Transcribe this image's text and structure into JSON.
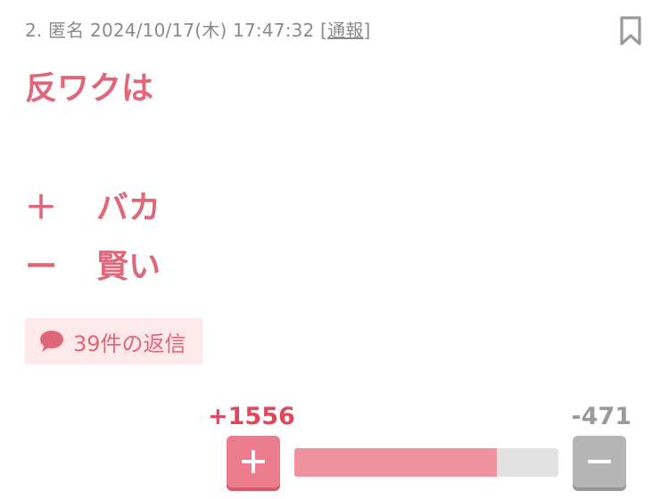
{
  "meta": {
    "number": "2.",
    "author": "匿名",
    "datetime": "2024/10/17(木) 17:47:32",
    "report_open": "[",
    "report_label": "通報",
    "report_close": "]"
  },
  "body": {
    "title": "反ワクは",
    "plus_mark": "＋",
    "plus_text": "バカ",
    "minus_mark": "ー",
    "minus_text": "賢い"
  },
  "replies": {
    "label": "39件の返信"
  },
  "votes": {
    "plus_count": "+1556",
    "minus_count": "-471",
    "plus_ratio": 0.768
  },
  "colors": {
    "accent": "#e0667a",
    "plus": "#ec7c8c",
    "minus": "#b5b5b5",
    "reply_bg": "#fde8ea"
  },
  "icons": {
    "bookmark": "bookmark-icon",
    "reply": "speech-bubble-icon",
    "plus": "plus-icon",
    "minus": "minus-icon"
  }
}
